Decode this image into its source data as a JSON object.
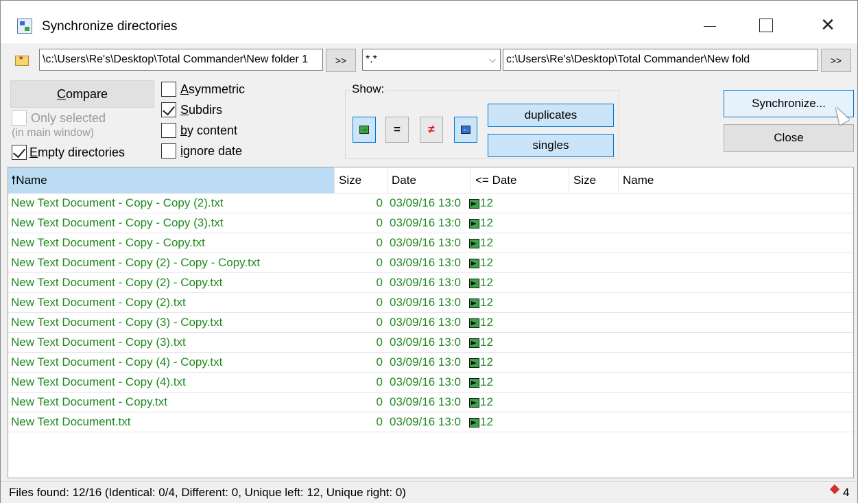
{
  "window": {
    "title": "Synchronize directories"
  },
  "paths": {
    "left": "c:\\Users\\Re's\\Desktop\\Total Commander\\New folder 1\\",
    "mask": "*.*",
    "right": "c:\\Users\\Re's\\Desktop\\Total Commander\\New fold",
    "browse_label": ">>"
  },
  "options": {
    "compare_label": "Compare",
    "only_selected": "Only selected",
    "in_main_window": "(in main window)",
    "empty_dirs": "Empty directories",
    "asymmetric": "Asymmetric",
    "subdirs": "Subdirs",
    "by_content": "by content",
    "ignore_date": "ignore date"
  },
  "show": {
    "label": "Show:",
    "equal_label": "=",
    "neq_label": "≠",
    "duplicates_label": "duplicates",
    "singles_label": "singles"
  },
  "actions": {
    "synchronize_label": "Synchronize...",
    "close_label": "Close"
  },
  "columns": {
    "name": "Name",
    "size": "Size",
    "date": "Date",
    "cmp_date": "<= Date",
    "size2": "Size",
    "name2": "Name"
  },
  "rows": [
    {
      "name": "New Text Document - Copy - Copy (2).txt",
      "size": "0",
      "date": "03/09/16 13:0",
      "tail": "12"
    },
    {
      "name": "New Text Document - Copy - Copy (3).txt",
      "size": "0",
      "date": "03/09/16 13:0",
      "tail": "12"
    },
    {
      "name": "New Text Document - Copy - Copy.txt",
      "size": "0",
      "date": "03/09/16 13:0",
      "tail": "12"
    },
    {
      "name": "New Text Document - Copy (2) - Copy - Copy.txt",
      "size": "0",
      "date": "03/09/16 13:0",
      "tail": "12"
    },
    {
      "name": "New Text Document - Copy (2) - Copy.txt",
      "size": "0",
      "date": "03/09/16 13:0",
      "tail": "12"
    },
    {
      "name": "New Text Document - Copy (2).txt",
      "size": "0",
      "date": "03/09/16 13:0",
      "tail": "12"
    },
    {
      "name": "New Text Document - Copy (3) - Copy.txt",
      "size": "0",
      "date": "03/09/16 13:0",
      "tail": "12"
    },
    {
      "name": "New Text Document - Copy (3).txt",
      "size": "0",
      "date": "03/09/16 13:0",
      "tail": "12"
    },
    {
      "name": "New Text Document - Copy (4) - Copy.txt",
      "size": "0",
      "date": "03/09/16 13:0",
      "tail": "12"
    },
    {
      "name": "New Text Document - Copy (4).txt",
      "size": "0",
      "date": "03/09/16 13:0",
      "tail": "12"
    },
    {
      "name": "New Text Document - Copy.txt",
      "size": "0",
      "date": "03/09/16 13:0",
      "tail": "12"
    },
    {
      "name": "New Text Document.txt",
      "size": "0",
      "date": "03/09/16 13:0",
      "tail": "12"
    }
  ],
  "status": {
    "text": "Files found: 12/16  (Identical: 0/4, Different: 0, Unique left: 12, Unique right: 0)",
    "count": "4"
  },
  "colors": {
    "unique_left": "#1e8a1e",
    "header_sorted": "#bcdcf4",
    "accent": "#0078d7"
  }
}
